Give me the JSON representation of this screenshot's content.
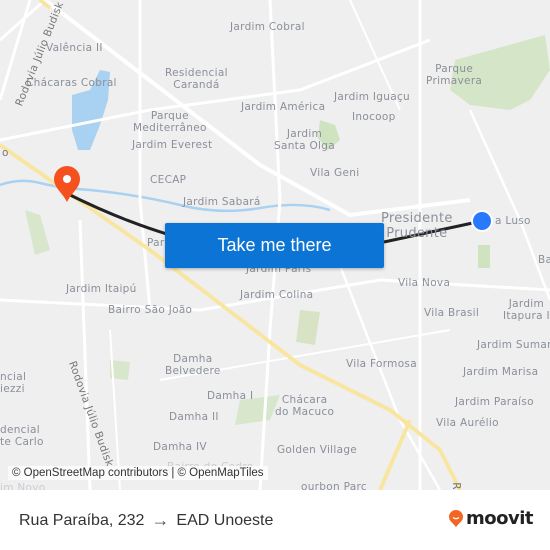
{
  "map": {
    "labels": [
      {
        "id": "jardim-cobral",
        "text": "Jardim Cobral"
      },
      {
        "id": "valencia-ii",
        "text": "Valência II"
      },
      {
        "id": "chacaras-cobral",
        "text": "Chácaras Cobral"
      },
      {
        "id": "residencial-caranda",
        "text": "Residencial\nCarandá"
      },
      {
        "id": "parque-primavera",
        "text": "Parque\nPrimavera"
      },
      {
        "id": "jardim-america",
        "text": "Jardim América"
      },
      {
        "id": "jardim-iguacu",
        "text": "Jardim Iguaçu"
      },
      {
        "id": "inocoop",
        "text": "Inocoop"
      },
      {
        "id": "parque-mediterraneo",
        "text": "Parque\nMediterrâneo"
      },
      {
        "id": "jardim-everest",
        "text": "Jardim Everest"
      },
      {
        "id": "jardim-santa-olga",
        "text": "Jardim\nSanta Olga"
      },
      {
        "id": "cecap",
        "text": "CECAP"
      },
      {
        "id": "vila-geni",
        "text": "Vila Geni"
      },
      {
        "id": "jardim-sabara",
        "text": "Jardim Sabará"
      },
      {
        "id": "presidente-prudente",
        "text": "Presidente\nPrudente"
      },
      {
        "id": "vila-luso",
        "text": "a Luso"
      },
      {
        "id": "ba",
        "text": "Ba"
      },
      {
        "id": "par",
        "text": "Par"
      },
      {
        "id": "jardim-paris",
        "text": "Jardim Paris"
      },
      {
        "id": "jardim-itaipu",
        "text": "Jardim Itaipú"
      },
      {
        "id": "jardim-colina",
        "text": "Jardim Colina"
      },
      {
        "id": "vila-nova",
        "text": "Vila Nova"
      },
      {
        "id": "bairro-sao-joao",
        "text": "Bairro São João"
      },
      {
        "id": "vila-brasil",
        "text": "Vila Brasil"
      },
      {
        "id": "jardim-itapura",
        "text": "Jardim\nItapura I"
      },
      {
        "id": "jardim-sumare",
        "text": "Jardim Sumar"
      },
      {
        "id": "damha-belvedere",
        "text": "Damha\nBelvedere"
      },
      {
        "id": "vila-formosa",
        "text": "Vila Formosa"
      },
      {
        "id": "jardim-marisa",
        "text": "Jardim Marisa"
      },
      {
        "id": "damha-i",
        "text": "Damha I"
      },
      {
        "id": "chacara-do-macuco",
        "text": "Chácara\ndo Macuco"
      },
      {
        "id": "jardim-paraiso",
        "text": "Jardim Paraíso"
      },
      {
        "id": "damha-ii",
        "text": "Damha II"
      },
      {
        "id": "vila-aurelio",
        "text": "Vila Aurélio"
      },
      {
        "id": "damha-iv",
        "text": "Damha IV"
      },
      {
        "id": "golden-village",
        "text": "Golden Village"
      },
      {
        "id": "bourbon-parc",
        "text": "ourbon Parc"
      },
      {
        "id": "residencial-ziezzi",
        "text": "ncial\niezzi"
      },
      {
        "id": "residencial-monte-carlo",
        "text": "dencial\nte Carlo"
      },
      {
        "id": "bairro-do-cedro",
        "text": "Bairro do Cedro"
      },
      {
        "id": "jardim-novo",
        "text": "im Novo"
      }
    ],
    "road_labels": [
      {
        "id": "rodovia-julio-budisk-top",
        "text": "Rodovia Júlio Budisk"
      },
      {
        "id": "rodovia-julio-budisk-bottom",
        "text": "Rodovia Júlio Budisk"
      },
      {
        "id": "road-r",
        "text": "R"
      },
      {
        "id": "road-o",
        "text": "o"
      }
    ],
    "origin_marker": "origin-dot",
    "destination_marker": "destination-pin",
    "colors": {
      "route": "#222222",
      "origin": "#2979ff",
      "destination": "#f4511e",
      "water": "#a9d2f2",
      "park": "#cfe3c0",
      "highway": "#f8e6a0"
    }
  },
  "cta": {
    "label": "Take me there"
  },
  "attribution": "© OpenStreetMap contributors | © OpenMapTiles",
  "footer": {
    "origin": "Rua Paraíba, 232",
    "arrow": "→",
    "destination": "EAD Unoeste",
    "brand": "moovit",
    "brand_color": "#f26522"
  }
}
